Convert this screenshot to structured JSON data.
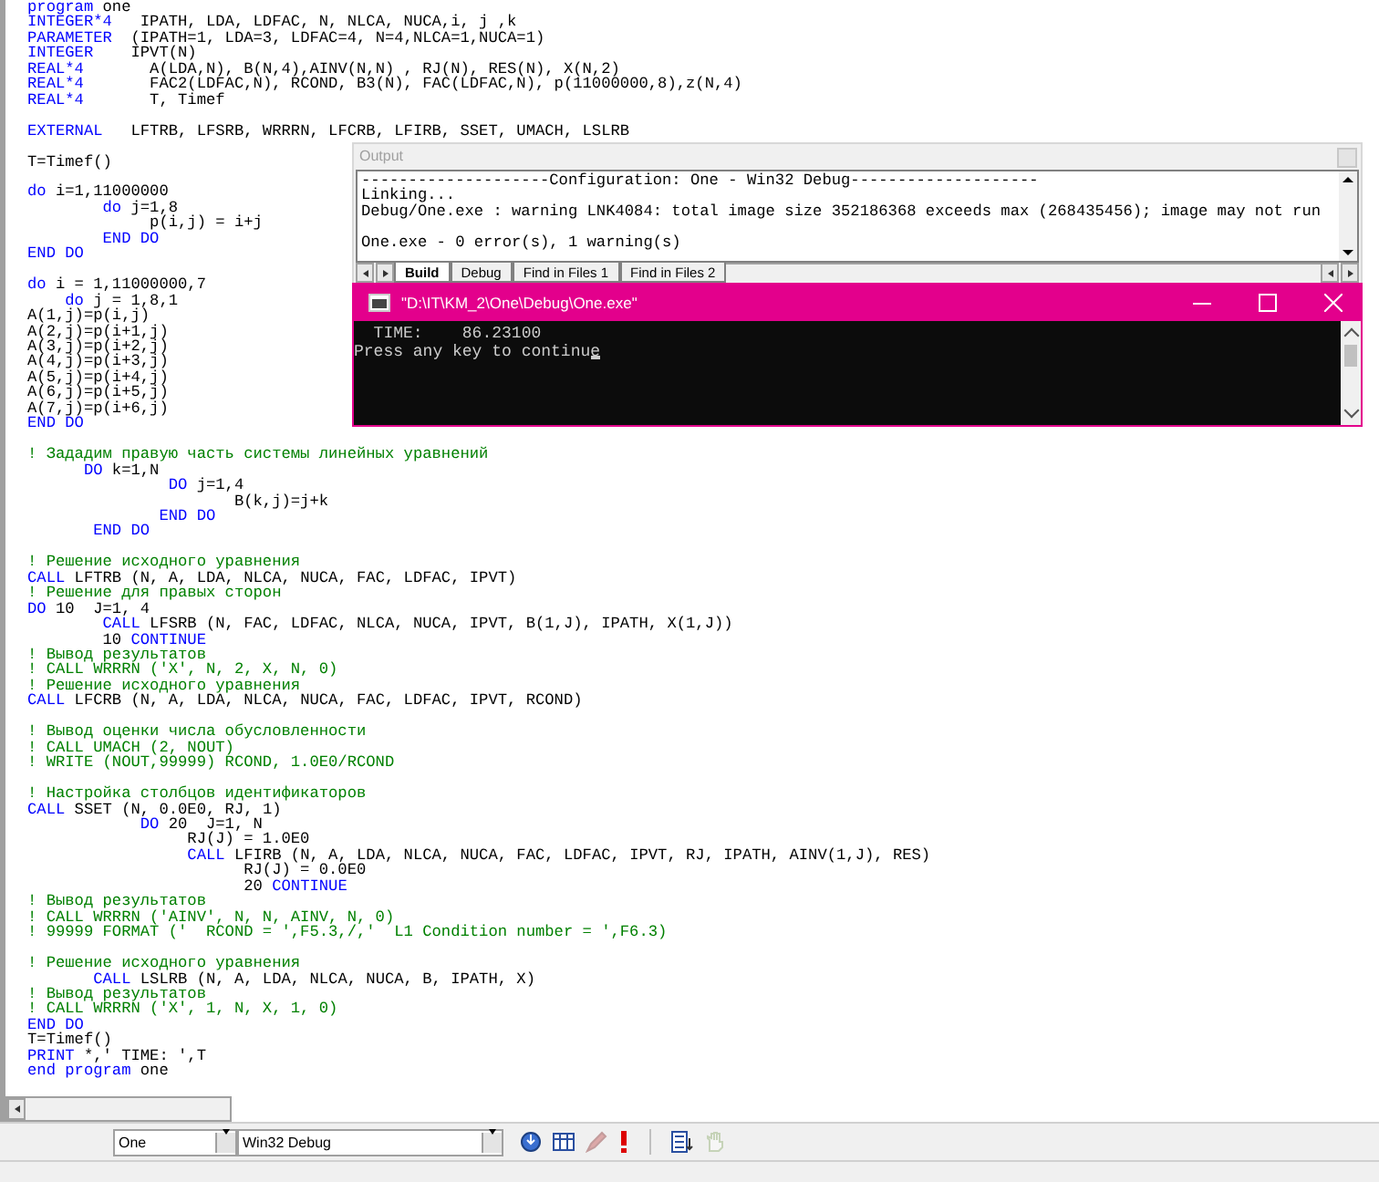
{
  "editor": {
    "lines": [
      {
        "kind": "code",
        "parts": [
          {
            "kind": "keyword",
            "text": "program"
          },
          {
            "kind": "plain",
            "text": " one"
          }
        ]
      },
      {
        "kind": "code",
        "parts": [
          {
            "kind": "keyword",
            "text": "INTEGER*4"
          },
          {
            "kind": "plain",
            "text": "   IPATH, LDA, LDFAC, N, NLCA, NUCA,i, j ,k"
          }
        ]
      },
      {
        "kind": "code",
        "parts": [
          {
            "kind": "keyword",
            "text": "PARAMETER"
          },
          {
            "kind": "plain",
            "text": "  (IPATH=1, LDA=3, LDFAC=4, N=4,NLCA=1,NUCA=1)"
          }
        ]
      },
      {
        "kind": "code",
        "parts": [
          {
            "kind": "keyword",
            "text": "INTEGER"
          },
          {
            "kind": "plain",
            "text": "    IPVT(N)"
          }
        ]
      },
      {
        "kind": "code",
        "parts": [
          {
            "kind": "keyword",
            "text": "REAL*4"
          },
          {
            "kind": "plain",
            "text": "       A(LDA,N), B(N,4),AINV(N,N) , RJ(N), RES(N), X(N,2)"
          }
        ]
      },
      {
        "kind": "code",
        "parts": [
          {
            "kind": "keyword",
            "text": "REAL*4"
          },
          {
            "kind": "plain",
            "text": "       FAC2(LDFAC,N), RCOND, B3(N), FAC(LDFAC,N), p(11000000,8),z(N,4)"
          }
        ]
      },
      {
        "kind": "code",
        "parts": [
          {
            "kind": "keyword",
            "text": "REAL*4"
          },
          {
            "kind": "plain",
            "text": "       T, Timef"
          }
        ]
      },
      {
        "kind": "blank"
      },
      {
        "kind": "code",
        "parts": [
          {
            "kind": "keyword",
            "text": "EXTERNAL"
          },
          {
            "kind": "plain",
            "text": "   LFTRB, LFSRB, WRRRN, LFCRB, LFIRB, SSET, UMACH, LSLRB"
          }
        ]
      },
      {
        "kind": "blank"
      },
      {
        "kind": "code",
        "parts": [
          {
            "kind": "plain",
            "text": "T=Timef()"
          }
        ]
      },
      {
        "kind": "blank"
      },
      {
        "kind": "code",
        "parts": [
          {
            "kind": "keyword",
            "text": "do"
          },
          {
            "kind": "plain",
            "text": " i=1,11000000"
          }
        ]
      },
      {
        "kind": "code",
        "parts": [
          {
            "kind": "keyword",
            "text": "        do"
          },
          {
            "kind": "plain",
            "text": " j=1,8"
          }
        ]
      },
      {
        "kind": "code",
        "parts": [
          {
            "kind": "plain",
            "text": "             p(i,j) = i+j"
          }
        ]
      },
      {
        "kind": "code",
        "parts": [
          {
            "kind": "keyword",
            "text": "        END DO"
          }
        ]
      },
      {
        "kind": "code",
        "parts": [
          {
            "kind": "keyword",
            "text": "END DO"
          }
        ]
      },
      {
        "kind": "blank"
      },
      {
        "kind": "code",
        "parts": [
          {
            "kind": "keyword",
            "text": "do"
          },
          {
            "kind": "plain",
            "text": " i = 1,11000000,7"
          }
        ]
      },
      {
        "kind": "code",
        "parts": [
          {
            "kind": "keyword",
            "text": "    do"
          },
          {
            "kind": "plain",
            "text": " j = 1,8,1"
          }
        ]
      },
      {
        "kind": "code",
        "parts": [
          {
            "kind": "plain",
            "text": "A(1,j)=p(i,j)"
          }
        ]
      },
      {
        "kind": "code",
        "parts": [
          {
            "kind": "plain",
            "text": "A(2,j)=p(i+1,j)"
          }
        ]
      },
      {
        "kind": "code",
        "parts": [
          {
            "kind": "plain",
            "text": "A(3,j)=p(i+2,j)"
          }
        ]
      },
      {
        "kind": "code",
        "parts": [
          {
            "kind": "plain",
            "text": "A(4,j)=p(i+3,j)"
          }
        ]
      },
      {
        "kind": "code",
        "parts": [
          {
            "kind": "plain",
            "text": "A(5,j)=p(i+4,j)"
          }
        ]
      },
      {
        "kind": "code",
        "parts": [
          {
            "kind": "plain",
            "text": "A(6,j)=p(i+5,j)"
          }
        ]
      },
      {
        "kind": "code",
        "parts": [
          {
            "kind": "plain",
            "text": "A(7,j)=p(i+6,j)"
          }
        ]
      },
      {
        "kind": "code",
        "parts": [
          {
            "kind": "keyword",
            "text": "END DO"
          }
        ]
      },
      {
        "kind": "blank"
      },
      {
        "kind": "comment",
        "text": "! Зададим правую часть системы линейных уравнений"
      },
      {
        "kind": "code",
        "parts": [
          {
            "kind": "keyword",
            "text": "      DO"
          },
          {
            "kind": "plain",
            "text": " k=1,N"
          }
        ]
      },
      {
        "kind": "code",
        "parts": [
          {
            "kind": "keyword",
            "text": "               DO"
          },
          {
            "kind": "plain",
            "text": " j=1,4"
          }
        ]
      },
      {
        "kind": "code",
        "parts": [
          {
            "kind": "plain",
            "text": "                      B(k,j)=j+k"
          }
        ]
      },
      {
        "kind": "code",
        "parts": [
          {
            "kind": "keyword",
            "text": "              END DO"
          }
        ]
      },
      {
        "kind": "code",
        "parts": [
          {
            "kind": "keyword",
            "text": "       END DO"
          }
        ]
      },
      {
        "kind": "blank"
      },
      {
        "kind": "comment",
        "text": "! Решение исходного уравнения"
      },
      {
        "kind": "code",
        "parts": [
          {
            "kind": "keyword",
            "text": "CALL"
          },
          {
            "kind": "plain",
            "text": " LFTRB (N, A, LDA, NLCA, NUCA, FAC, LDFAC, IPVT)"
          }
        ]
      },
      {
        "kind": "comment",
        "text": "! Решение для правых сторон"
      },
      {
        "kind": "code",
        "parts": [
          {
            "kind": "keyword",
            "text": "DO"
          },
          {
            "kind": "plain",
            "text": " 10  J=1, 4"
          }
        ]
      },
      {
        "kind": "code",
        "parts": [
          {
            "kind": "keyword",
            "text": "        CALL"
          },
          {
            "kind": "plain",
            "text": " LFSRB (N, FAC, LDFAC, NLCA, NUCA, IPVT, B(1,J), IPATH, X(1,J))"
          }
        ]
      },
      {
        "kind": "code",
        "parts": [
          {
            "kind": "plain",
            "text": "        10 "
          },
          {
            "kind": "keyword",
            "text": "CONTINUE"
          }
        ]
      },
      {
        "kind": "comment",
        "text": "! Вывод результатов"
      },
      {
        "kind": "comment",
        "text": "! CALL WRRRN ('X', N, 2, X, N, 0)"
      },
      {
        "kind": "comment",
        "text": "! Решение исходного уравнения"
      },
      {
        "kind": "code",
        "parts": [
          {
            "kind": "keyword",
            "text": "CALL"
          },
          {
            "kind": "plain",
            "text": " LFCRB (N, A, LDA, NLCA, NUCA, FAC, LDFAC, IPVT, RCOND)"
          }
        ]
      },
      {
        "kind": "blank"
      },
      {
        "kind": "comment",
        "text": "! Вывод оценки числа обусловленности"
      },
      {
        "kind": "comment",
        "text": "! CALL UMACH (2, NOUT)"
      },
      {
        "kind": "comment",
        "text": "! WRITE (NOUT,99999) RCOND, 1.0E0/RCOND"
      },
      {
        "kind": "blank"
      },
      {
        "kind": "comment",
        "text": "! Настройка столбцов идентификаторов"
      },
      {
        "kind": "code",
        "parts": [
          {
            "kind": "keyword",
            "text": "CALL"
          },
          {
            "kind": "plain",
            "text": " SSET (N, 0.0E0, RJ, 1)"
          }
        ]
      },
      {
        "kind": "code",
        "parts": [
          {
            "kind": "keyword",
            "text": "            DO"
          },
          {
            "kind": "plain",
            "text": " 20  J=1, N"
          }
        ]
      },
      {
        "kind": "code",
        "parts": [
          {
            "kind": "plain",
            "text": "                 RJ(J) = 1.0E0"
          }
        ]
      },
      {
        "kind": "code",
        "parts": [
          {
            "kind": "keyword",
            "text": "                 CALL"
          },
          {
            "kind": "plain",
            "text": " LFIRB (N, A, LDA, NLCA, NUCA, FAC, LDFAC, IPVT, RJ, IPATH, AINV(1,J), RES)"
          }
        ]
      },
      {
        "kind": "code",
        "parts": [
          {
            "kind": "plain",
            "text": "                       RJ(J) = 0.0E0"
          }
        ]
      },
      {
        "kind": "code",
        "parts": [
          {
            "kind": "plain",
            "text": "                       20 "
          },
          {
            "kind": "keyword",
            "text": "CONTINUE"
          }
        ]
      },
      {
        "kind": "comment",
        "text": "! Вывод результатов"
      },
      {
        "kind": "comment",
        "text": "! CALL WRRRN ('AINV', N, N, AINV, N, 0)"
      },
      {
        "kind": "comment",
        "text": "! 99999 FORMAT ('  RCOND = ',F5.3,/,'  L1 Condition number = ',F6.3)"
      },
      {
        "kind": "blank"
      },
      {
        "kind": "comment",
        "text": "! Решение исходного уравнения"
      },
      {
        "kind": "code",
        "parts": [
          {
            "kind": "keyword",
            "text": "       CALL"
          },
          {
            "kind": "plain",
            "text": " LSLRB (N, A, LDA, NLCA, NUCA, B, IPATH, X)"
          }
        ]
      },
      {
        "kind": "comment",
        "text": "! Вывод результатов"
      },
      {
        "kind": "comment",
        "text": "! CALL WRRRN ('X', 1, N, X, 1, 0)"
      },
      {
        "kind": "code",
        "parts": [
          {
            "kind": "keyword",
            "text": "END DO"
          }
        ]
      },
      {
        "kind": "code",
        "parts": [
          {
            "kind": "plain",
            "text": "T=Timef()"
          }
        ]
      },
      {
        "kind": "code",
        "parts": [
          {
            "kind": "keyword",
            "text": "PRINT"
          },
          {
            "kind": "plain",
            "text": " *,' TIME: ',T"
          }
        ]
      },
      {
        "kind": "code",
        "parts": [
          {
            "kind": "keyword",
            "text": "end program"
          },
          {
            "kind": "plain",
            "text": " one"
          }
        ]
      }
    ]
  },
  "output_panel": {
    "title": "Output",
    "lines": [
      {
        "kind": "text",
        "text": "--------------------Configuration: One - Win32 Debug--------------------"
      },
      {
        "kind": "text",
        "text": "Linking..."
      },
      {
        "kind": "text",
        "text": "Debug/One.exe : warning LNK4084: total image size 352186368 exceeds max (268435456); image may not run"
      },
      {
        "kind": "blank"
      },
      {
        "kind": "text",
        "text": "One.exe - 0 error(s), 1 warning(s)"
      }
    ],
    "tabs": [
      {
        "label": "Build",
        "selected": true
      },
      {
        "label": "Debug",
        "selected": false
      },
      {
        "label": "Find in Files 1",
        "selected": false
      },
      {
        "label": "Find in Files 2",
        "selected": false
      }
    ]
  },
  "console": {
    "title": "\"D:\\IT\\KM_2\\One\\Debug\\One.exe\"",
    "lines": [
      "  TIME:    86.23100",
      "Press any key to continue"
    ],
    "cursor": true
  },
  "toolbar": {
    "project": "One",
    "configuration": "Win32 Debug",
    "buttons": [
      {
        "kind": "compile",
        "disabled": false
      },
      {
        "kind": "build",
        "disabled": false
      },
      {
        "kind": "stop",
        "disabled": true
      },
      {
        "kind": "execute",
        "disabled": false
      },
      {
        "kind": "breakpoint",
        "disabled": false
      },
      {
        "kind": "hand",
        "disabled": true
      }
    ]
  }
}
